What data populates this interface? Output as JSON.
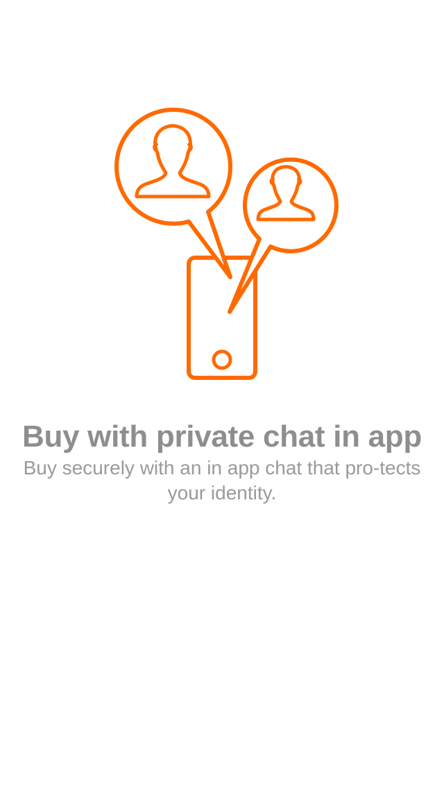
{
  "onboarding": {
    "title": "Buy with private chat in app",
    "subtitle": "Buy securely with an in app chat that pro-tects your identity."
  },
  "illustration": {
    "icons": [
      "chat-bubble-person-icon",
      "phone-icon"
    ],
    "accent_color": "#ff6a00"
  },
  "colors": {
    "background": "#ffffff",
    "text": "#8e8e8e"
  }
}
